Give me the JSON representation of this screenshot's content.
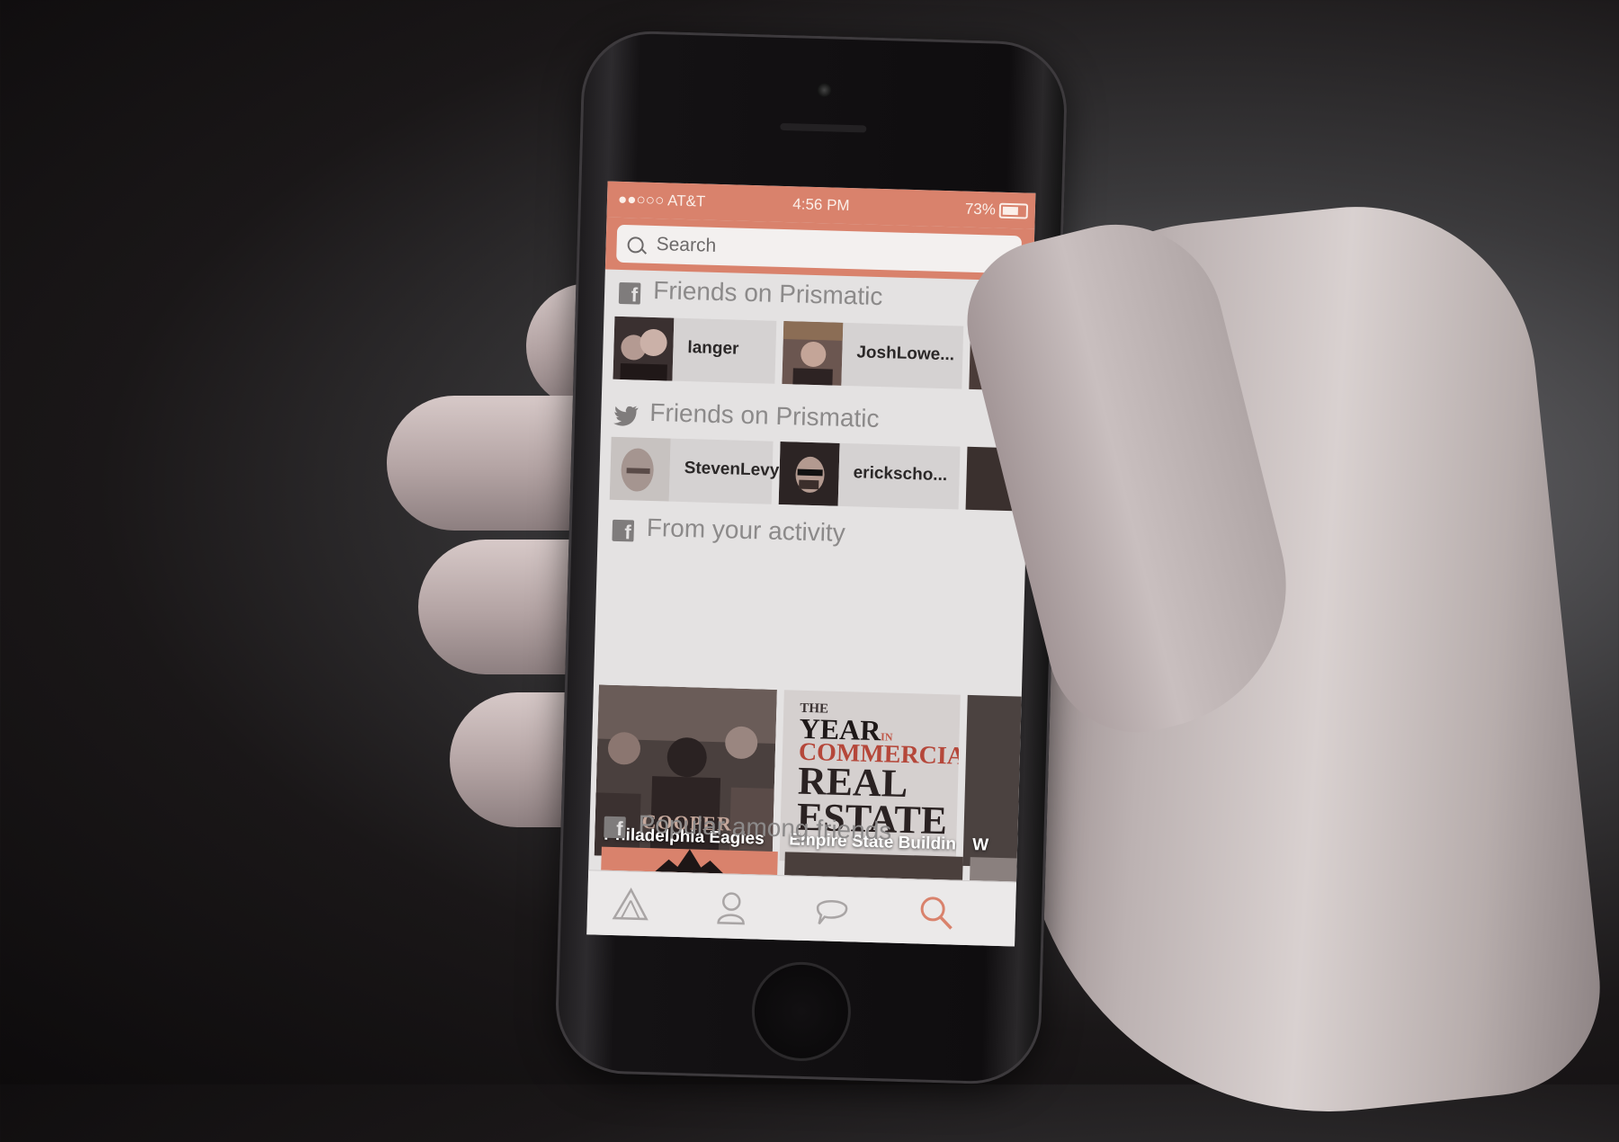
{
  "status_bar": {
    "carrier": "●●○○○ AT&T",
    "time": "4:56 PM",
    "battery": "73%"
  },
  "search": {
    "placeholder": "Search"
  },
  "sections": {
    "facebook_friends": {
      "title": "Friends on Prismatic",
      "icon": "facebook-icon",
      "friends": [
        "langer",
        "JoshLowe..."
      ]
    },
    "twitter_friends": {
      "title": "Friends on Prismatic",
      "icon": "twitter-icon",
      "friends": [
        "StevenLevy",
        "erickscho..."
      ]
    },
    "activity": {
      "title": "From your activity",
      "icon": "facebook-icon",
      "topics": [
        "Philadelphia Eagles",
        "Empire State Building",
        "W"
      ]
    },
    "popular": {
      "title": "Popular among friends",
      "icon": "facebook-icon"
    }
  },
  "poster": {
    "line1": "THE",
    "line2": "YEAR",
    "line2_small": "IN",
    "line3": "COMMERCIAL",
    "line4": "REAL",
    "line5": "ESTATE"
  },
  "jersey_text": "COOPER",
  "tab_bar": {
    "tabs": [
      "home-tab",
      "profile-tab",
      "messages-tab",
      "search-tab"
    ],
    "active": "search-tab"
  },
  "colors": {
    "accent": "#d9826c",
    "screen_bg": "#e4e2e2",
    "section_text": "#8c8a8a"
  }
}
